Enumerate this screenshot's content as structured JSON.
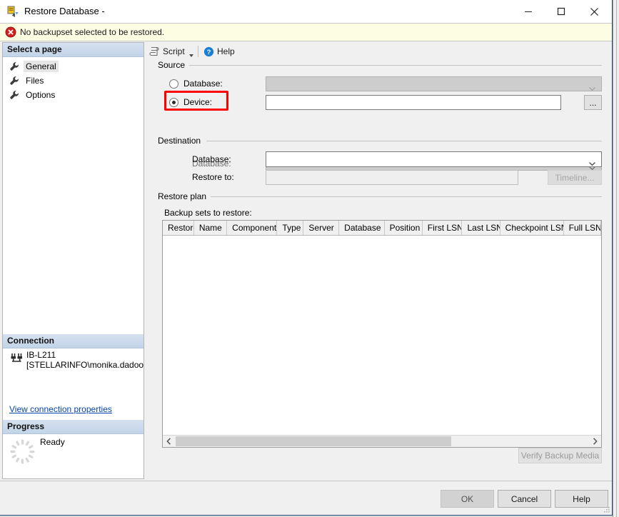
{
  "window": {
    "title": "Restore Database -",
    "icon": "restore-database-icon",
    "minimize_label": "Minimize",
    "maximize_label": "Maximize",
    "close_label": "Close"
  },
  "message_bar": {
    "icon": "error-circle-icon",
    "text": "No backupset selected to be restored."
  },
  "sidebar": {
    "select_page_header": "Select a page",
    "pages": [
      {
        "label": "General",
        "icon": "wrench-icon",
        "selected": true
      },
      {
        "label": "Files",
        "icon": "wrench-icon",
        "selected": false
      },
      {
        "label": "Options",
        "icon": "wrench-icon",
        "selected": false
      }
    ],
    "connection_header": "Connection",
    "connection_server": "IB-L211",
    "connection_user": "[STELLARINFO\\monika.dadool]",
    "connection_icon": "server-connection-icon",
    "view_connection_properties": "View connection properties",
    "progress_header": "Progress",
    "progress_status": "Ready",
    "progress_icon": "spinner-icon"
  },
  "toolbar": {
    "script_label": "Script",
    "script_icon": "script-icon",
    "script_dropdown_icon": "chevron-down-icon",
    "help_label": "Help",
    "help_icon": "help-circle-icon"
  },
  "source": {
    "group_label": "Source",
    "database_radio_label": "Database:",
    "database_radio_checked": false,
    "database_combo_value": "",
    "device_radio_label": "Device:",
    "device_radio_checked": true,
    "device_input_value": "",
    "device_input_placeholder": "",
    "browse_button_label": "...",
    "device_database_label": "Database:",
    "device_database_value": ""
  },
  "destination": {
    "group_label": "Destination",
    "database_label": "Database:",
    "database_value": "",
    "restore_to_label": "Restore to:",
    "restore_to_value": "",
    "timeline_button_label": "Timeline..."
  },
  "restore_plan": {
    "group_label": "Restore plan",
    "backup_sets_label": "Backup sets to restore:",
    "columns": [
      "Restore",
      "Name",
      "Component",
      "Type",
      "Server",
      "Database",
      "Position",
      "First LSN",
      "Last LSN",
      "Checkpoint LSN",
      "Full LSN"
    ],
    "rows": [],
    "verify_button_label": "Verify Backup Media",
    "scroll_left_icon": "chevron-left-icon",
    "scroll_right_icon": "chevron-right-icon"
  },
  "footer": {
    "ok_label": "OK",
    "cancel_label": "Cancel",
    "help_label": "Help"
  },
  "annotation": {
    "color": "#ff0000",
    "target": "device-radio"
  }
}
